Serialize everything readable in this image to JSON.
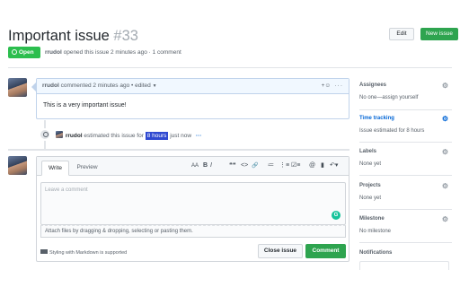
{
  "issue": {
    "title": "Important issue",
    "number": "#33",
    "state": "Open",
    "author": "rrudol",
    "meta_rest": "opened this issue 2 minutes ago · 1 comment"
  },
  "actions": {
    "edit": "Edit",
    "new_issue": "New issue"
  },
  "comment": {
    "author": "rrudol",
    "meta": "commented 2 minutes ago • edited",
    "reaction_glyph": "+☺",
    "more_glyph": "···",
    "body": "This is a very important issue!"
  },
  "event": {
    "author": "rrudol",
    "text_before": "estimated this issue for",
    "highlight": "8 hours",
    "text_after": "just now",
    "more": "···"
  },
  "editor": {
    "tab_write": "Write",
    "tab_preview": "Preview",
    "toolbar": [
      "AA",
      "B",
      "I",
      "❝❝",
      "<>",
      "🔗",
      "≔",
      "⋮≡",
      "☑≡",
      "@",
      "▮",
      "↶▾"
    ],
    "placeholder": "Leave a comment",
    "attach_hint": "Attach files by dragging & dropping, selecting or pasting them.",
    "markdown_note": "Styling with Markdown is supported",
    "close_button": "Close issue",
    "comment_button": "Comment",
    "grammarly": "G"
  },
  "sidebar": {
    "assignees": {
      "heading": "Assignees",
      "value": "No one—assign yourself"
    },
    "time_tracking": {
      "heading": "Time tracking",
      "value": "Issue estimated for 8 hours"
    },
    "labels": {
      "heading": "Labels",
      "value": "None yet"
    },
    "projects": {
      "heading": "Projects",
      "value": "None yet"
    },
    "milestone": {
      "heading": "Milestone",
      "value": "No milestone"
    },
    "notifications": {
      "heading": "Notifications"
    }
  },
  "colors": {
    "accent_green": "#2ea44f",
    "link_blue": "#0366d6",
    "highlight_blue": "#2f49d1",
    "comment_header": "#f1f8ff"
  }
}
